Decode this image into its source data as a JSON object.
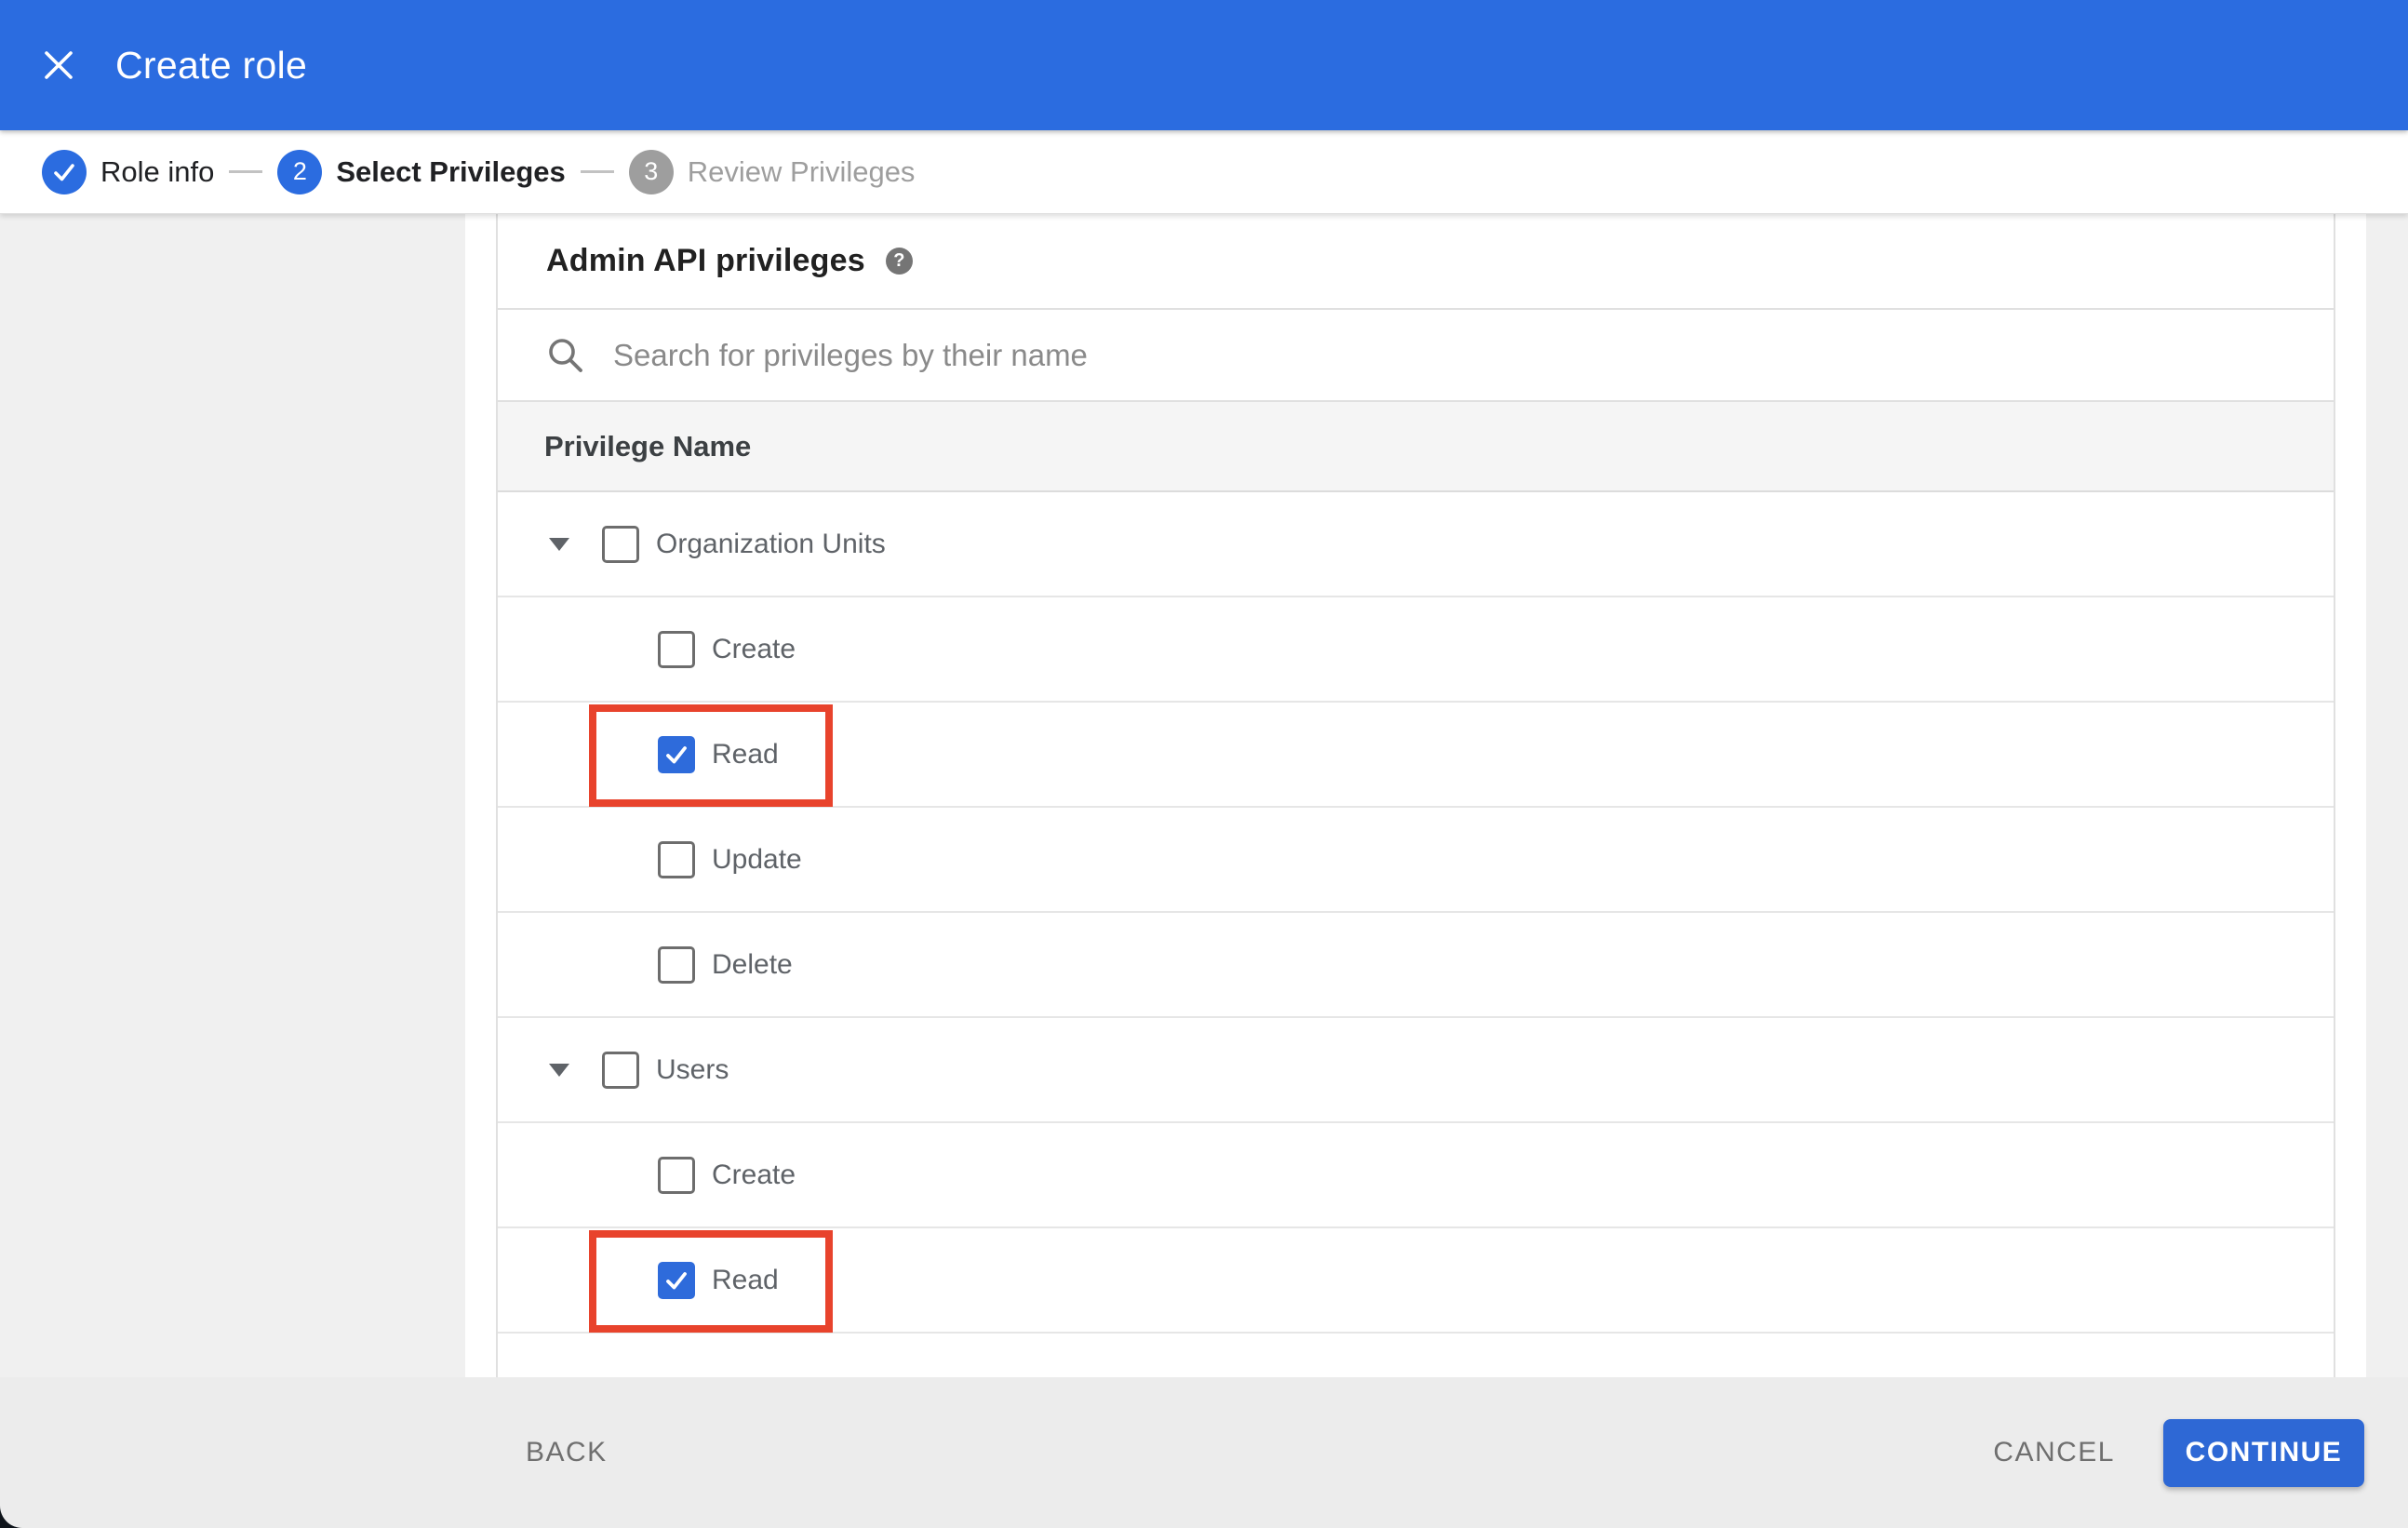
{
  "appbar": {
    "title": "Create role",
    "close_icon": "x-icon",
    "bg_color": "#2b6ce0"
  },
  "stepper": {
    "steps": [
      {
        "number": 1,
        "label": "Role info",
        "state": "complete",
        "icon": "check-icon"
      },
      {
        "number": 2,
        "label": "Select Privileges",
        "state": "active"
      },
      {
        "number": 3,
        "label": "Review Privileges",
        "state": "upcoming"
      }
    ]
  },
  "content": {
    "section_title": "Admin API privileges",
    "help_icon": "?",
    "search": {
      "placeholder": "Search for privileges by their name",
      "value": "",
      "icon": "search-icon"
    },
    "table": {
      "column_header": "Privilege Name",
      "groups": [
        {
          "label": "Organization Units",
          "checked": false,
          "expanded": true,
          "children": [
            {
              "label": "Create",
              "checked": false,
              "highlighted": false
            },
            {
              "label": "Read",
              "checked": true,
              "highlighted": true
            },
            {
              "label": "Update",
              "checked": false,
              "highlighted": false
            },
            {
              "label": "Delete",
              "checked": false,
              "highlighted": false
            }
          ]
        },
        {
          "label": "Users",
          "checked": false,
          "expanded": true,
          "children": [
            {
              "label": "Create",
              "checked": false,
              "highlighted": false
            },
            {
              "label": "Read",
              "checked": true,
              "highlighted": true
            }
          ]
        }
      ]
    }
  },
  "footer": {
    "back_label": "BACK",
    "cancel_label": "CANCEL",
    "continue_label": "CONTINUE"
  },
  "colors": {
    "accent_blue": "#2b6ce0",
    "button_blue": "#2e68d5",
    "checkbox_blue": "#2e6bdb",
    "highlight_red": "#e8432c",
    "inactive_gray": "#9e9e9e",
    "footer_bg": "#ececec",
    "page_bg": "#f0f0f0",
    "header_row_bg": "#f5f5f5"
  }
}
